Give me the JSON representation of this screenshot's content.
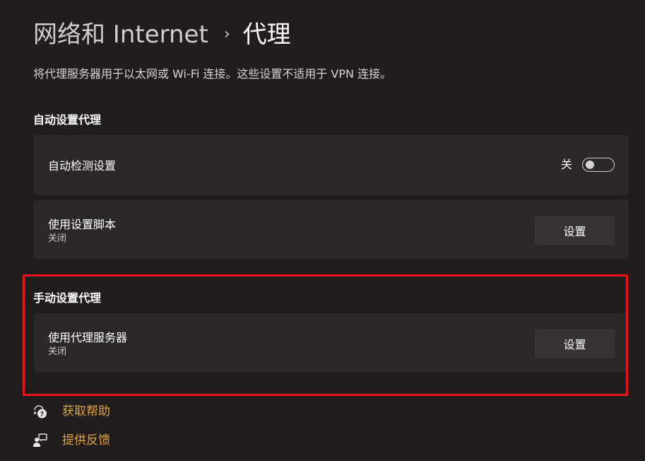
{
  "breadcrumb": {
    "parent": "网络和 Internet",
    "separator": "›",
    "current": "代理"
  },
  "description": "将代理服务器用于以太网或 Wi-Fi 连接。这些设置不适用于 VPN 连接。",
  "auto_section": {
    "heading": "自动设置代理",
    "detect": {
      "label": "自动检测设置",
      "toggle_state_label": "关",
      "toggle_on": false
    },
    "script": {
      "label": "使用设置脚本",
      "status": "关闭",
      "button_label": "设置"
    }
  },
  "manual_section": {
    "heading": "手动设置代理",
    "proxy_server": {
      "label": "使用代理服务器",
      "status": "关闭",
      "button_label": "设置"
    }
  },
  "footer": {
    "help": {
      "label": "获取帮助",
      "icon": "help-icon"
    },
    "feedback": {
      "label": "提供反馈",
      "icon": "feedback-icon"
    }
  },
  "colors": {
    "background": "#221c1c",
    "card": "#2d2828",
    "link": "#e0a83a",
    "highlight": "#e8141b"
  }
}
